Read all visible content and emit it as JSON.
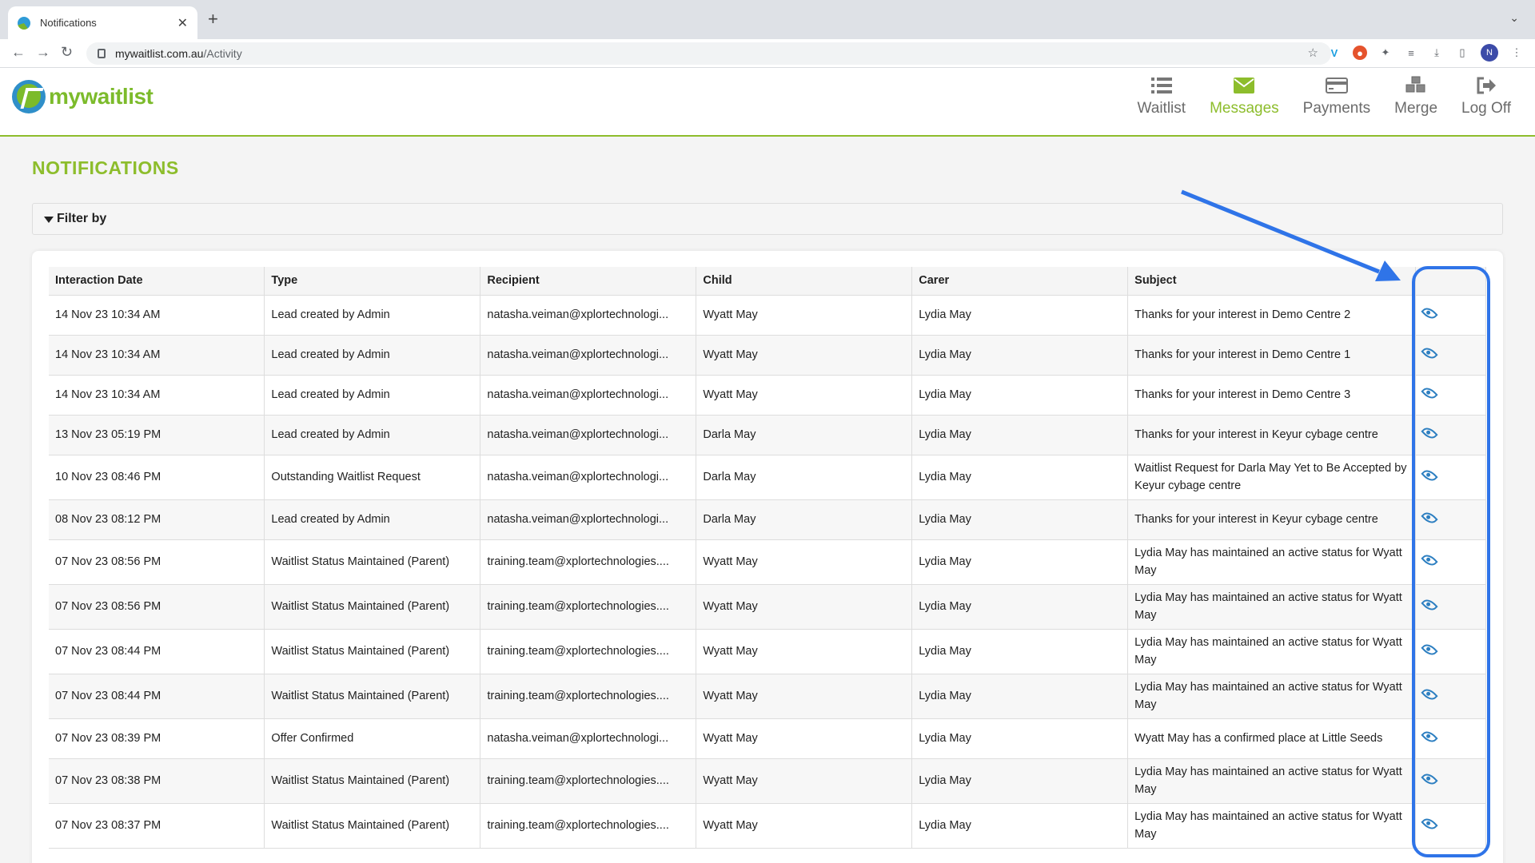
{
  "browser": {
    "tab_title": "Notifications",
    "url_host": "mywaitlist.com.au",
    "url_path": "/Activity",
    "profile_initial": "N"
  },
  "app": {
    "logo_text": "mywaitlist",
    "nav": [
      {
        "label": "Waitlist",
        "icon": "list-icon"
      },
      {
        "label": "Messages",
        "icon": "envelope-icon"
      },
      {
        "label": "Payments",
        "icon": "credit-card-icon"
      },
      {
        "label": "Merge",
        "icon": "cubes-icon"
      },
      {
        "label": "Log Off",
        "icon": "sign-out-icon"
      }
    ],
    "active_nav": "Messages",
    "accent_color": "#8dbd2c"
  },
  "page": {
    "title": "NOTIFICATIONS",
    "filter_label": "Filter by"
  },
  "table": {
    "headers": [
      "Interaction Date",
      "Type",
      "Recipient",
      "Child",
      "Carer",
      "Subject",
      ""
    ],
    "rows": [
      {
        "date": "14 Nov 23 10:34 AM",
        "type": "Lead created by Admin",
        "recipient": "natasha.veiman@xplortechnologi...",
        "child": "Wyatt May",
        "carer": "Lydia May",
        "subject": "Thanks for your interest in Demo Centre 2"
      },
      {
        "date": "14 Nov 23 10:34 AM",
        "type": "Lead created by Admin",
        "recipient": "natasha.veiman@xplortechnologi...",
        "child": "Wyatt May",
        "carer": "Lydia May",
        "subject": "Thanks for your interest in Demo Centre 1"
      },
      {
        "date": "14 Nov 23 10:34 AM",
        "type": "Lead created by Admin",
        "recipient": "natasha.veiman@xplortechnologi...",
        "child": "Wyatt May",
        "carer": "Lydia May",
        "subject": "Thanks for your interest in Demo Centre 3"
      },
      {
        "date": "13 Nov 23 05:19 PM",
        "type": "Lead created by Admin",
        "recipient": "natasha.veiman@xplortechnologi...",
        "child": "Darla May",
        "carer": "Lydia May",
        "subject": "Thanks for your interest in Keyur cybage centre"
      },
      {
        "date": "10 Nov 23 08:46 PM",
        "type": "Outstanding Waitlist Request",
        "recipient": "natasha.veiman@xplortechnologi...",
        "child": "Darla May",
        "carer": "Lydia May",
        "subject": "Waitlist Request for Darla May Yet to Be Accepted by Keyur cybage centre"
      },
      {
        "date": "08 Nov 23 08:12 PM",
        "type": "Lead created by Admin",
        "recipient": "natasha.veiman@xplortechnologi...",
        "child": "Darla May",
        "carer": "Lydia May",
        "subject": "Thanks for your interest in Keyur cybage centre"
      },
      {
        "date": "07 Nov 23 08:56 PM",
        "type": "Waitlist Status Maintained (Parent)",
        "recipient": "training.team@xplortechnologies....",
        "child": "Wyatt May",
        "carer": "Lydia May",
        "subject": "Lydia May has maintained an active status for Wyatt May"
      },
      {
        "date": "07 Nov 23 08:56 PM",
        "type": "Waitlist Status Maintained (Parent)",
        "recipient": "training.team@xplortechnologies....",
        "child": "Wyatt May",
        "carer": "Lydia May",
        "subject": "Lydia May has maintained an active status for Wyatt May"
      },
      {
        "date": "07 Nov 23 08:44 PM",
        "type": "Waitlist Status Maintained (Parent)",
        "recipient": "training.team@xplortechnologies....",
        "child": "Wyatt May",
        "carer": "Lydia May",
        "subject": "Lydia May has maintained an active status for Wyatt May"
      },
      {
        "date": "07 Nov 23 08:44 PM",
        "type": "Waitlist Status Maintained (Parent)",
        "recipient": "training.team@xplortechnologies....",
        "child": "Wyatt May",
        "carer": "Lydia May",
        "subject": "Lydia May has maintained an active status for Wyatt May"
      },
      {
        "date": "07 Nov 23 08:39 PM",
        "type": "Offer Confirmed",
        "recipient": "natasha.veiman@xplortechnologi...",
        "child": "Wyatt May",
        "carer": "Lydia May",
        "subject": "Wyatt May has a confirmed place at Little Seeds"
      },
      {
        "date": "07 Nov 23 08:38 PM",
        "type": "Waitlist Status Maintained (Parent)",
        "recipient": "training.team@xplortechnologies....",
        "child": "Wyatt May",
        "carer": "Lydia May",
        "subject": "Lydia May has maintained an active status for Wyatt May"
      },
      {
        "date": "07 Nov 23 08:37 PM",
        "type": "Waitlist Status Maintained (Parent)",
        "recipient": "training.team@xplortechnologies....",
        "child": "Wyatt May",
        "carer": "Lydia May",
        "subject": "Lydia May has maintained an active status for Wyatt May"
      }
    ],
    "view_icon": "eye-icon"
  },
  "annotation": {
    "color": "#2f74e8"
  }
}
